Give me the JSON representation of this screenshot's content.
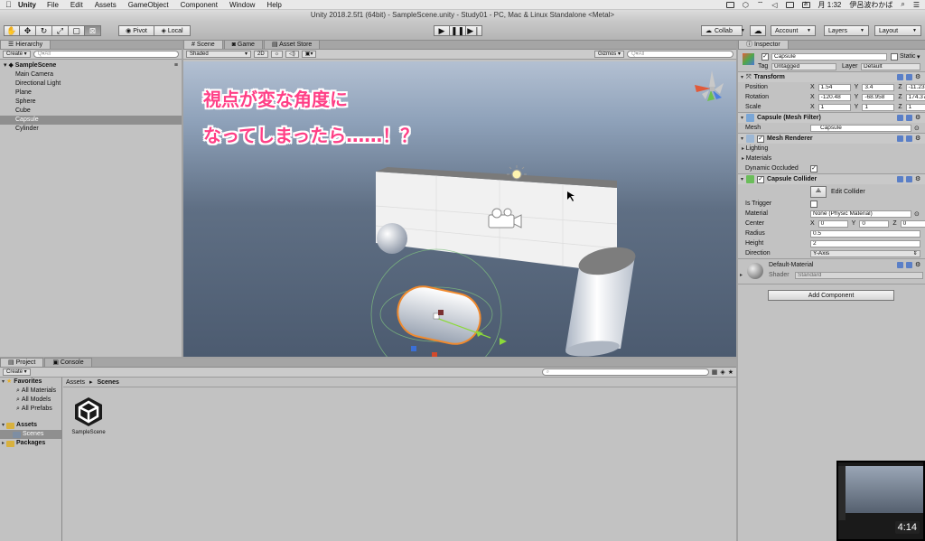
{
  "menubar": {
    "app": "Unity",
    "menus": [
      "File",
      "Edit",
      "Assets",
      "GameObject",
      "Component",
      "Window",
      "Help"
    ],
    "clock": "月 1:32",
    "user": "伊呂波わかば"
  },
  "window_title": "Unity 2018.2.5f1 (64bit) - SampleScene.unity - Study01 - PC, Mac & Linux Standalone <Metal>",
  "toolbar": {
    "pivot": "Pivot",
    "local": "Local",
    "collab": "Collab",
    "account": "Account",
    "layers": "Layers",
    "layout": "Layout"
  },
  "hierarchy": {
    "tab": "Hierarchy",
    "create": "Create",
    "search_placeholder": "Q▾All",
    "scene": "SampleScene",
    "items": [
      "Main Camera",
      "Directional Light",
      "Plane",
      "Sphere",
      "Cube",
      "Capsule",
      "Cylinder"
    ],
    "selected": "Capsule"
  },
  "scene": {
    "tabs": [
      "Scene",
      "Game",
      "Asset Store"
    ],
    "shading": "Shaded",
    "mode_2d": "2D",
    "gizmos": "Gizmos",
    "search_placeholder": "Q▾All",
    "caption_line1": "視点が変な角度に",
    "caption_line2": "なってしまったら……！？"
  },
  "inspector": {
    "tab": "Inspector",
    "object_name": "Capsule",
    "static_label": "Static",
    "tag_label": "Tag",
    "tag_value": "Untagged",
    "layer_label": "Layer",
    "layer_value": "Default",
    "transform": {
      "title": "Transform",
      "position_label": "Position",
      "rotation_label": "Rotation",
      "scale_label": "Scale",
      "position": [
        "1.54",
        "3.4",
        "-11.23"
      ],
      "rotation": [
        "-120.48",
        "-68.958",
        "174.372"
      ],
      "scale": [
        "1",
        "1",
        "1"
      ]
    },
    "mesh_filter": {
      "title": "Capsule (Mesh Filter)",
      "mesh_label": "Mesh",
      "mesh_value": "Capsule"
    },
    "mesh_renderer": {
      "title": "Mesh Renderer",
      "lighting": "Lighting",
      "materials": "Materials",
      "dynamic_occluded": "Dynamic Occluded"
    },
    "collider": {
      "title": "Capsule Collider",
      "edit_collider": "Edit Collider",
      "is_trigger": "Is Trigger",
      "material_label": "Material",
      "material_value": "None (Physic Material)",
      "center_label": "Center",
      "center": [
        "0",
        "0",
        "0"
      ],
      "radius_label": "Radius",
      "radius": "0.5",
      "height_label": "Height",
      "height": "2",
      "direction_label": "Direction",
      "direction": "Y-Axis"
    },
    "material": {
      "name": "Default-Material",
      "shader_label": "Shader",
      "shader_value": "Standard"
    },
    "add_component": "Add Component"
  },
  "project": {
    "tabs": [
      "Project",
      "Console"
    ],
    "create": "Create",
    "favorites": "Favorites",
    "favorite_items": [
      "All Materials",
      "All Models",
      "All Prefabs"
    ],
    "assets": "Assets",
    "scenes": "Scenes",
    "packages": "Packages",
    "breadcrumb_root": "Assets",
    "breadcrumb_sep": "▸",
    "breadcrumb_leaf": "Scenes",
    "asset_item": "SampleScene"
  },
  "video": {
    "time": "4:14"
  }
}
